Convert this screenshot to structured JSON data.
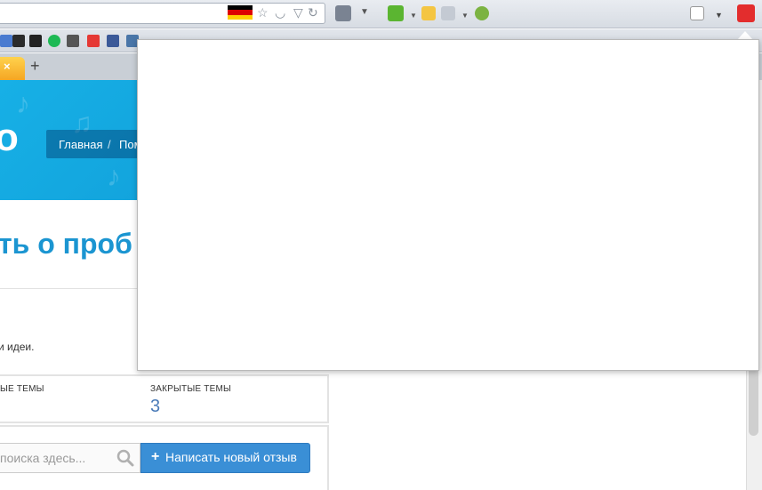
{
  "browser": {
    "icons": [
      "star-icon",
      "pocket-icon",
      "reload-icon",
      "dropdown-icon",
      "extension-icon",
      "reader-icon",
      "opera-icon"
    ]
  },
  "tabs": [
    {
      "close_glyph": "×"
    }
  ],
  "new_tab_glyph": "+",
  "page": {
    "logo_fragment": "o",
    "breadcrumb": {
      "home": "Главная",
      "separator": "/",
      "next": "Пом"
    },
    "headline_fragment": "ть о проб",
    "description_fragment": "и идеи.",
    "stats": {
      "open_label": "ЫЕ ТЕМЫ",
      "closed_label": "ЗАКРЫТЫЕ ТЕМЫ",
      "closed_value": "3"
    },
    "search": {
      "placeholder_fragment": "поиска здесь..."
    },
    "write_button": {
      "icon": "+",
      "label": "Написать новый отзыв"
    }
  },
  "colors": {
    "accent": "#1b95d1",
    "hero": "#17b0e6",
    "button": "#3a8fd6",
    "stat_value": "#4a7bb8"
  }
}
